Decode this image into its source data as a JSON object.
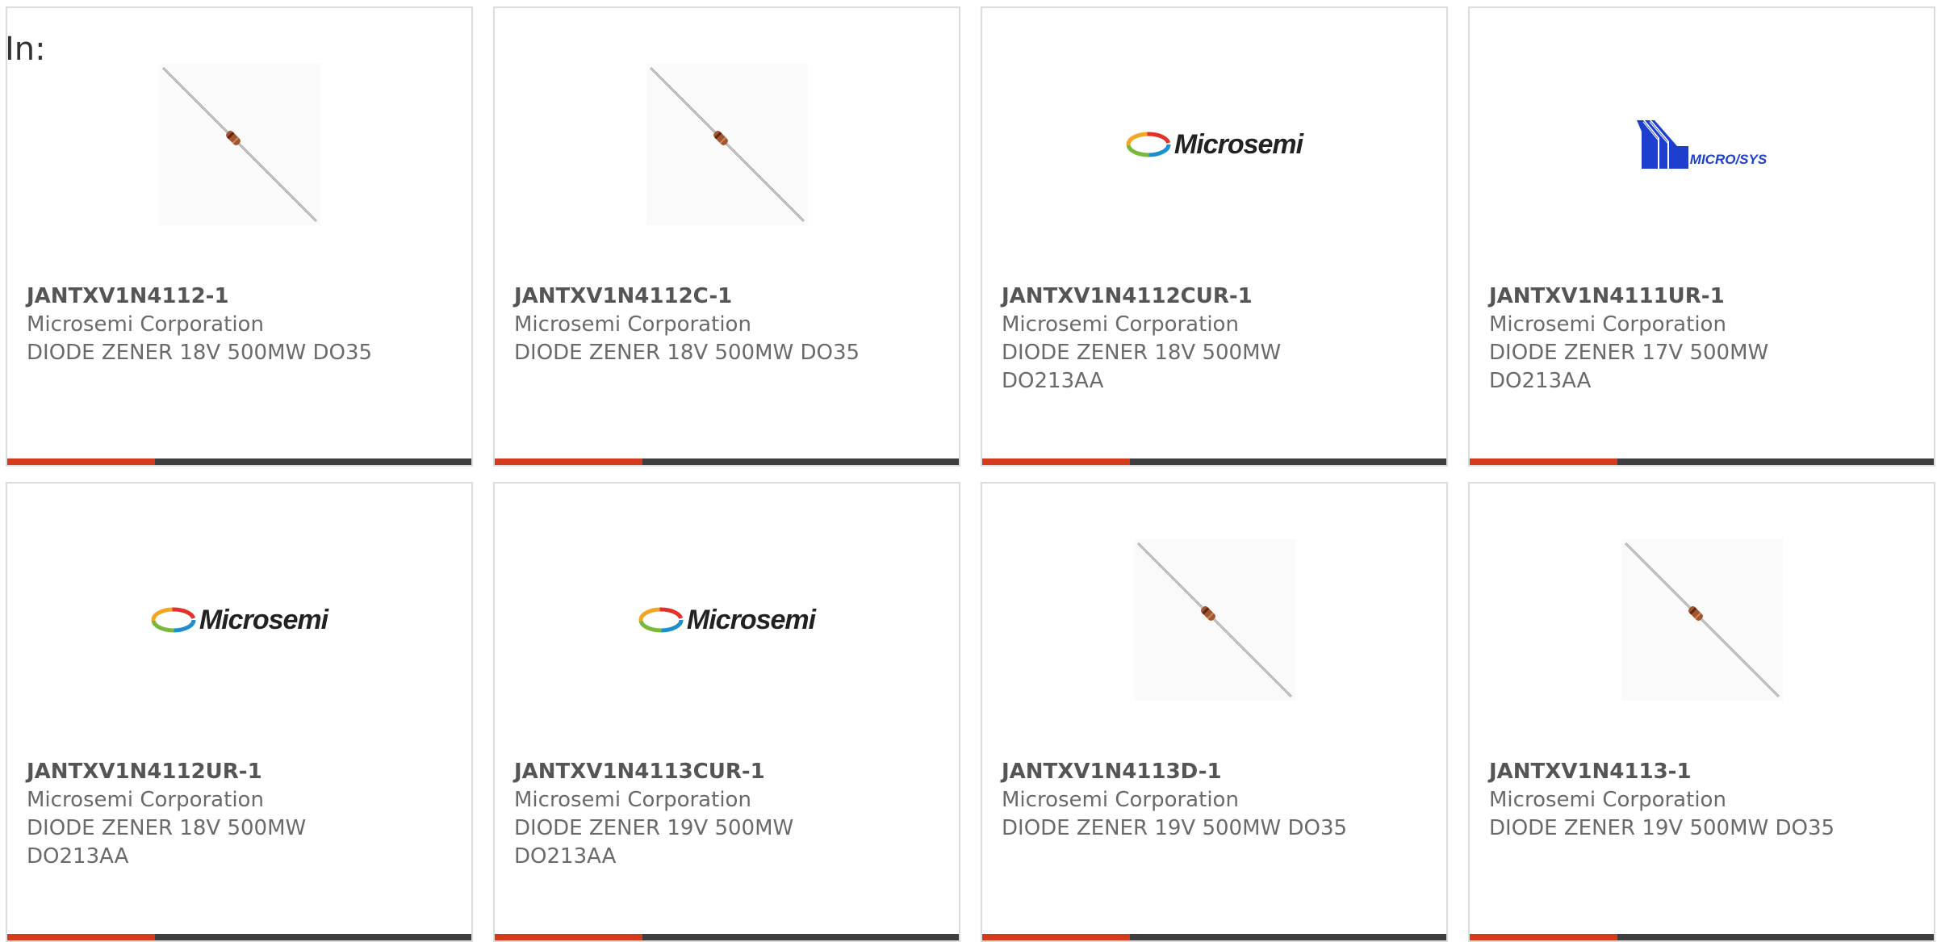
{
  "filter_label": "In:",
  "colors": {
    "accent_bar": "#d43a1b",
    "dark_bar": "#3e3e3e",
    "card_border": "#dcdcdc",
    "text": "#555555",
    "microsys_blue": "#1d3fcf"
  },
  "products": [
    {
      "part_number": "JANTXV1N4112-1",
      "manufacturer": "Microsemi Corporation",
      "description": "DIODE ZENER 18V 500MW DO35",
      "image": "axial-diode-photo"
    },
    {
      "part_number": "JANTXV1N4112C-1",
      "manufacturer": "Microsemi Corporation",
      "description": "DIODE ZENER 18V 500MW DO35",
      "image": "axial-diode-photo"
    },
    {
      "part_number": "JANTXV1N4112CUR-1",
      "manufacturer": "Microsemi Corporation",
      "description": "DIODE ZENER 18V 500MW DO213AA",
      "image": "microsemi-logo",
      "logo_text": "Microsemi"
    },
    {
      "part_number": "JANTXV1N4111UR-1",
      "manufacturer": "Microsemi Corporation",
      "description": "DIODE ZENER 17V 500MW DO213AA",
      "image": "microsys-logo",
      "logo_text": "MICRO/SYS"
    },
    {
      "part_number": "JANTXV1N4112UR-1",
      "manufacturer": "Microsemi Corporation",
      "description": "DIODE ZENER 18V 500MW DO213AA",
      "image": "microsemi-logo",
      "logo_text": "Microsemi"
    },
    {
      "part_number": "JANTXV1N4113CUR-1",
      "manufacturer": "Microsemi Corporation",
      "description": "DIODE ZENER 19V 500MW DO213AA",
      "image": "microsemi-logo",
      "logo_text": "Microsemi"
    },
    {
      "part_number": "JANTXV1N4113D-1",
      "manufacturer": "Microsemi Corporation",
      "description": "DIODE ZENER 19V 500MW DO35",
      "image": "axial-diode-photo"
    },
    {
      "part_number": "JANTXV1N4113-1",
      "manufacturer": "Microsemi Corporation",
      "description": "DIODE ZENER 19V 500MW DO35",
      "image": "axial-diode-photo"
    }
  ]
}
